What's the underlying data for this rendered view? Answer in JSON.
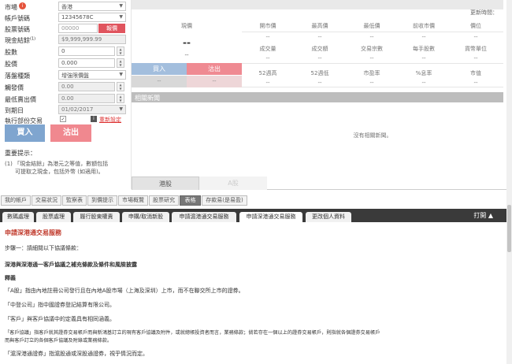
{
  "form": {
    "market_label": "市場",
    "market_value": "香港",
    "account_label": "帳戶號碼",
    "account_value": "12345678C",
    "stock_label": "股票號碼",
    "stock_value": "00000",
    "stock_btn": "報價",
    "cash_label": "現金結餘",
    "cash_sup": "(1)",
    "cash_value": "$9,999,999.99",
    "qty_label": "股數",
    "qty_value": "0",
    "price_label": "股價",
    "price_value": "0.000",
    "order_type_label": "落盤種類",
    "order_type_value": "增強限價盤",
    "trigger_label": "觸發價",
    "trigger_value": "0.00",
    "min_price_label": "最低賣出價",
    "min_price_value": "0.00",
    "expiry_label": "到期日",
    "expiry_value": "01/02/2017",
    "partial_label": "執行部份交易",
    "reset_link": "重新設定",
    "buy_btn": "買入",
    "sell_btn": "沽出",
    "notice_title": "重要提示：",
    "notice_1": "(1) 「現金結餘」為港元之等值，數額包括",
    "notice_2": "可提取之現金，包括外幣 (如適用)。"
  },
  "quote": {
    "update_time": "更新時間：",
    "cur_price": "現價",
    "dash": "--",
    "headers1": [
      "開市價",
      "最高價",
      "最低價",
      "前收市價",
      "價位"
    ],
    "headers2": [
      "成交量",
      "成交額",
      "交易宗數",
      "每手股數",
      "貨幣單位"
    ],
    "headers3": [
      "52週高",
      "52週低",
      "市盈率",
      "%息率",
      "市值"
    ],
    "buy": "買入",
    "sell": "沽出",
    "news_title": "相關新聞",
    "no_news": "沒有相關新聞。",
    "tab_hk": "港股",
    "tab_a": "A股"
  },
  "nav": [
    "我的帳戶",
    "交易狀況",
    "監察表",
    "到價提示",
    "市場概覽",
    "股票研究",
    "表格",
    "存款易(是易盈)"
  ],
  "subnav": [
    "數碼處理",
    "股票處理",
    "履行股東權責",
    "申購/取消新股",
    "申請滬港通交易服務",
    "申請深港通交易服務",
    "更改個人資料"
  ],
  "print_label": "打開 ▲",
  "doc": {
    "title": "申請深港通交易服務",
    "step": "步驟一：請細閱以下協議條款：",
    "heading": "深港與深港通一客戶協議之補充條款及條件和風險披露",
    "def": "釋義",
    "p1": "「A股」指由內地註冊公司發行且在內地A股市場（上海及深圳）上市，而不在聯交所上市的證券。",
    "p2": "「中登公司」指中國證券登記結算有限公司。",
    "p3": "「客戶」與客戶協議中的定義具有相同涵義。",
    "p4a": "「客戶協議」指客戶就其證券交易帳戶而與新鴻基訂立的現有客戶協議及附件，或就總帳投資者而言，業務條款；倘若存在一個以上的證券交易帳戶，則指就各個證券交易帳戶",
    "p4b": "而與客戶訂立的各個客戶協議及附錄或業務條款。",
    "p5": "「滬深港通證券」指滬股通或深股通證券，視乎情況而定。"
  }
}
